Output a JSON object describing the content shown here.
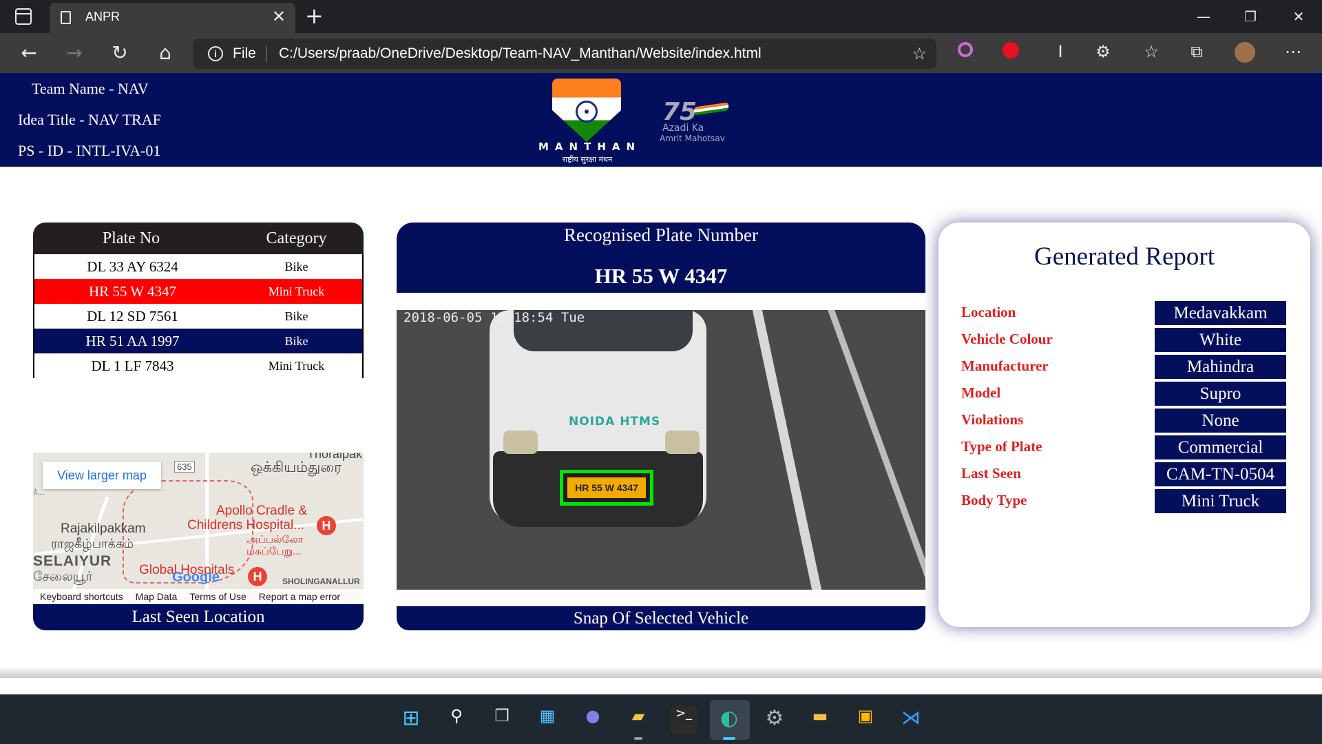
{
  "browser": {
    "tab_title": "ANPR",
    "address_scheme": "File",
    "address_url": "C:/Users/praab/OneDrive/Desktop/Team-NAV_Manthan/Website/index.html"
  },
  "header": {
    "team_name": "Team Name - NAV",
    "idea_title": "Idea Title - NAV TRAF",
    "ps_id": "PS - ID - INTL-IVA-01",
    "logo_text": "MANTHAN",
    "logo_subtext": "राष्ट्रीय सुरक्षा मंथन",
    "azadi_number": "75",
    "azadi_line1": "Azadi Ka",
    "azadi_line2": "Amrit Mahotsav"
  },
  "plate_table": {
    "columns": [
      "Plate No",
      "Category"
    ],
    "rows": [
      {
        "plate": "DL 33 AY 6324",
        "category": "Bike",
        "style": "white"
      },
      {
        "plate": "HR 55 W 4347",
        "category": "Mini Truck",
        "style": "red"
      },
      {
        "plate": "DL 12 SD 7561",
        "category": "Bike",
        "style": "white"
      },
      {
        "plate": "HR 51 AA 1997",
        "category": "Bike",
        "style": "navy"
      },
      {
        "plate": "DL 1 LF 7843",
        "category": "Mini Truck",
        "style": "white"
      }
    ]
  },
  "map": {
    "view_larger": "View larger map",
    "route_badge": "635",
    "labels": {
      "thoraipak": "Thoraipak",
      "okkiyam": "ஒக்கியம்துரை",
      "apollo1": "Apollo Cradle &",
      "apollo2": "Childrens Hospital...",
      "apollo_ta1": "அப்பல்லோ",
      "apollo_ta2": "மகப்பேறு...",
      "rajakil": "Rajakilpakkam",
      "rajakil_ta": "ராஜகீழ்பாக்கம்",
      "selaiyur": "SELAIYUR",
      "selaiyur_ta": "சேலையூர்",
      "global": "Global Hospitals",
      "google": "Google",
      "sholinganallur": "SHOLINGANALLUR",
      "left_stub": "ர்..."
    },
    "footer": [
      "Keyboard shortcuts",
      "Map Data",
      "Terms of Use",
      "Report a map error"
    ],
    "caption": "Last Seen Location"
  },
  "recognition": {
    "title": "Recognised Plate Number",
    "plate_number": "HR 55 W 4347",
    "snap_timestamp": "2018-06-05 15:18:54 Tue",
    "snap_plate_text": "HR 55 W 4347",
    "snap_van_text": "NOIDA HTMS",
    "snap_caption": "Snap Of Selected Vehicle"
  },
  "report": {
    "title": "Generated Report",
    "fields": [
      {
        "label": "Location",
        "value": "Medavakkam"
      },
      {
        "label": "Vehicle Colour",
        "value": "White"
      },
      {
        "label": "Manufacturer",
        "value": "Mahindra"
      },
      {
        "label": "Model",
        "value": "Supro"
      },
      {
        "label": "Violations",
        "value": "None"
      },
      {
        "label": "Type of Plate",
        "value": "Commercial"
      },
      {
        "label": "Last Seen",
        "value": "CAM-TN-0504"
      },
      {
        "label": "Body Type",
        "value": "Mini Truck"
      }
    ]
  },
  "colors": {
    "navy": "#030f5c",
    "highlight_red": "#ff0000",
    "label_red": "#e02020",
    "detection_green": "#00e600"
  },
  "icons": {
    "browser": [
      "window-icon",
      "document-icon",
      "close-icon",
      "plus-icon",
      "minimize-icon",
      "restore-icon",
      "back-arrow-icon",
      "forward-arrow-icon",
      "refresh-icon",
      "home-icon",
      "info-icon",
      "add-favorite-icon",
      "extension-icon",
      "favorites-icon",
      "collections-icon",
      "profile-avatar",
      "more-icon"
    ],
    "taskbar": [
      "windows-start-icon",
      "search-icon",
      "task-view-icon",
      "widgets-icon",
      "teams-chat-icon",
      "file-explorer-icon",
      "terminal-icon",
      "edge-icon",
      "settings-icon",
      "folder-icon",
      "microsoft-store-icon",
      "vscode-icon"
    ]
  }
}
